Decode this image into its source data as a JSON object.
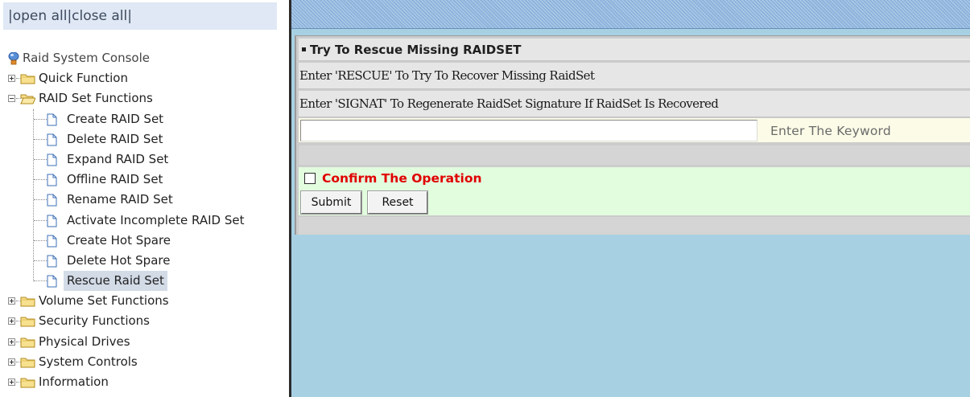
{
  "tree_header": {
    "pipe1": "|",
    "open_all": "open all",
    "pipe2": "|",
    "close_all": "close all",
    "pipe3": "|"
  },
  "tree": {
    "root": "Raid System Console",
    "quick_function": "Quick Function",
    "raid_set_functions": "RAID Set Functions",
    "raid_set_items": [
      "Create RAID Set",
      "Delete RAID Set",
      "Expand RAID Set",
      "Offline RAID Set",
      "Rename RAID Set",
      "Activate Incomplete RAID Set",
      "Create Hot Spare",
      "Delete Hot Spare",
      "Rescue Raid Set"
    ],
    "selected_item": "Rescue Raid Set",
    "volume_set_functions": "Volume Set Functions",
    "security_functions": "Security Functions",
    "physical_drives": "Physical Drives",
    "system_controls": "System Controls",
    "information": "Information"
  },
  "main": {
    "title": "Try To Rescue Missing RAIDSET",
    "line1": "Enter 'RESCUE' To Try To Recover Missing RaidSet",
    "line2": "Enter 'SIGNAT' To Regenerate RaidSet Signature If RaidSet Is Recovered",
    "keyword_value": "",
    "keyword_hint": "Enter The Keyword",
    "confirm_label": "Confirm The Operation",
    "confirm_checked": false,
    "submit_label": "Submit",
    "reset_label": "Reset"
  },
  "colors": {
    "tree_header_bg": "#dfe8f4",
    "selected_item_bg": "#d3dbe7",
    "right_pane_bg": "#a8d0e3",
    "topbar": "#8cb3dc",
    "keyword_row_bg": "#fbfbe7",
    "confirm_row_bg": "#e2fcde",
    "confirm_text": "#e00000"
  },
  "icons": {
    "root": "raid-console-icon",
    "folder": "folder-icon",
    "document": "document-icon",
    "expander": "tree-expander-icon"
  }
}
